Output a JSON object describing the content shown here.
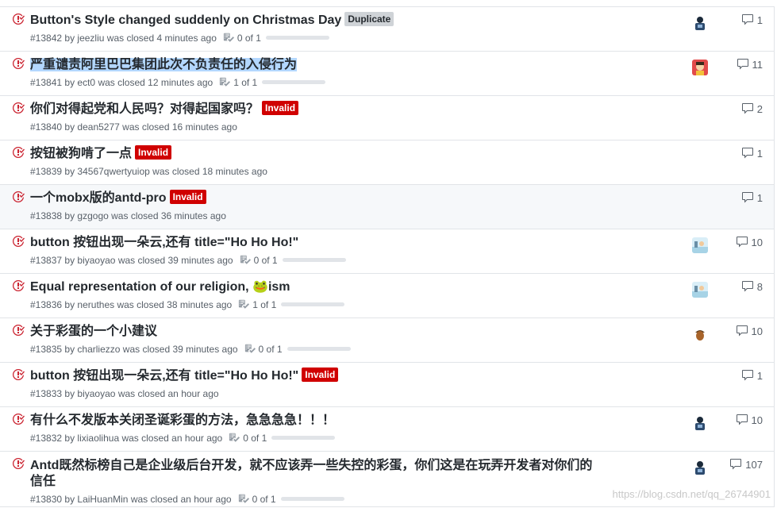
{
  "colors": {
    "closed": "#cb2431",
    "duplicate_bg": "#cfd3d7",
    "invalid_bg": "#d00000"
  },
  "issues": [
    {
      "title": "Button's Style changed suddenly on Christmas Day",
      "labels": [
        {
          "text": "Duplicate",
          "bg": "#cfd3d7",
          "fg": "#24292e"
        }
      ],
      "number": "#13842",
      "by": "by",
      "author": "jeezliu",
      "status": "was closed 4 minutes ago",
      "progress": "0 of 1",
      "progress_fraction": 0,
      "avatar": "avatar-dark",
      "comments": "1"
    },
    {
      "title": "严重谴责阿里巴巴集团此次不负责任的入侵行为",
      "labels": [],
      "number": "#13841",
      "by": "by",
      "author": "ect0",
      "status": "was closed 12 minutes ago",
      "progress": "1 of 1",
      "progress_fraction": 0,
      "avatar": "avatar-red",
      "comments": "11",
      "selected": true
    },
    {
      "title": "你们对得起党和人民吗？对得起国家吗？",
      "labels": [
        {
          "text": "Invalid",
          "bg": "#d00000",
          "fg": "#ffffff"
        }
      ],
      "number": "#13840",
      "by": "by",
      "author": "dean5277",
      "status": "was closed 16 minutes ago",
      "comments": "2"
    },
    {
      "title": "按钮被狗啃了一点",
      "labels": [
        {
          "text": "Invalid",
          "bg": "#d00000",
          "fg": "#ffffff"
        }
      ],
      "number": "#13839",
      "by": "by",
      "author": "34567qwertyuiop",
      "status": "was closed 18 minutes ago",
      "comments": "1"
    },
    {
      "title": "一个mobx版的antd-pro",
      "labels": [
        {
          "text": "Invalid",
          "bg": "#d00000",
          "fg": "#ffffff"
        }
      ],
      "number": "#13838",
      "by": "by",
      "author": "gzgogo",
      "status": "was closed 36 minutes ago",
      "comments": "1",
      "hover": true
    },
    {
      "title": "button 按钮出现一朵云,还有 title=\"Ho Ho Ho!\"",
      "labels": [],
      "number": "#13837",
      "by": "by",
      "author": "biyaoyao",
      "status": "was closed 39 minutes ago",
      "progress": "0 of 1",
      "progress_fraction": 0,
      "avatar": "avatar-beach",
      "comments": "10"
    },
    {
      "title": "Equal representation of our religion, 🐸ism",
      "labels": [],
      "number": "#13836",
      "by": "by",
      "author": "neruthes",
      "status": "was closed 38 minutes ago",
      "progress": "1 of 1",
      "progress_fraction": 0,
      "avatar": "avatar-beach",
      "comments": "8"
    },
    {
      "title": "关于彩蛋的一个小建议",
      "labels": [],
      "number": "#13835",
      "by": "by",
      "author": "charliezzo",
      "status": "was closed 39 minutes ago",
      "progress": "0 of 1",
      "progress_fraction": 0,
      "avatar": "avatar-acorn",
      "comments": "10"
    },
    {
      "title": "button 按钮出现一朵云,还有 title=\"Ho Ho Ho!\"",
      "labels": [
        {
          "text": "Invalid",
          "bg": "#d00000",
          "fg": "#ffffff"
        }
      ],
      "number": "#13833",
      "by": "by",
      "author": "biyaoyao",
      "status": "was closed an hour ago",
      "comments": "1"
    },
    {
      "title": "有什么不发版本关闭圣诞彩蛋的方法，急急急急！！！",
      "labels": [],
      "number": "#13832",
      "by": "by",
      "author": "lixiaolihua",
      "status": "was closed an hour ago",
      "progress": "0 of 1",
      "progress_fraction": 0,
      "avatar": "avatar-dark",
      "comments": "10"
    },
    {
      "title": "Antd既然标榜自己是企业级后台开发，就不应该弄一些失控的彩蛋，你们这是在玩弄开发者对你们的信任",
      "labels": [],
      "number": "#13830",
      "by": "by",
      "author": "LaiHuanMin",
      "status": "was closed an hour ago",
      "progress": "0 of 1",
      "progress_fraction": 0,
      "avatar": "avatar-dark",
      "comments": "107",
      "tall": true
    }
  ],
  "watermark": "https://blog.csdn.net/qq_26744901"
}
